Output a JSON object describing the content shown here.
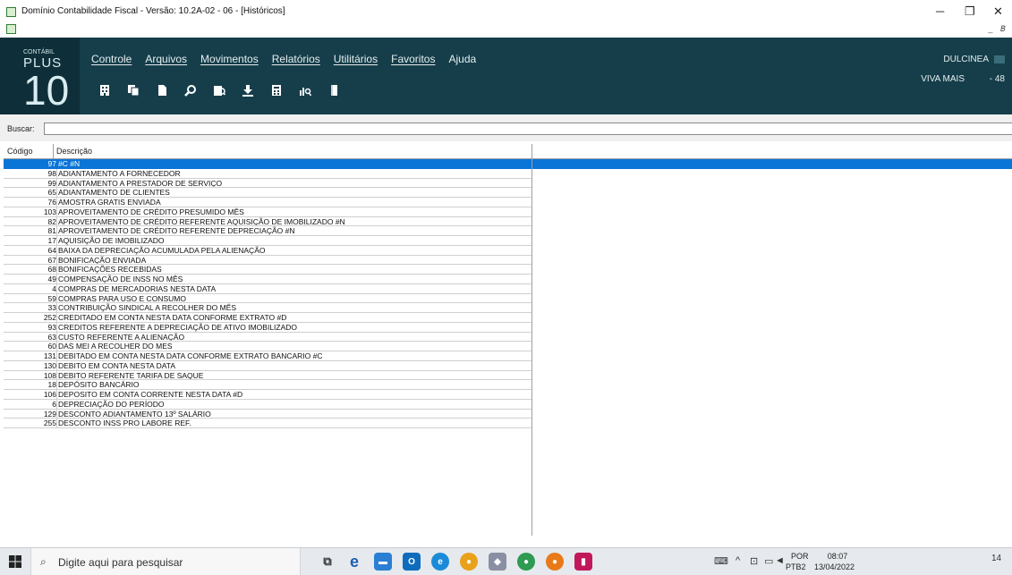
{
  "window": {
    "title": "Domínio Contabilidade Fiscal  - Versão: 10.2A-02 - 06 - [Históricos]"
  },
  "logo": {
    "small": "CONTÁBIL",
    "plus": "PLUS",
    "ten": "10"
  },
  "menu": [
    "Controle",
    "Arquivos",
    "Movimentos",
    "Relatórios",
    "Utilitários",
    "Favoritos",
    "Ajuda"
  ],
  "toolbar_icons": [
    "building-icon",
    "copy-icon",
    "document-icon",
    "search-icon",
    "report-icon",
    "download-icon",
    "calculator-icon",
    "chart-search-icon",
    "exit-door-icon"
  ],
  "user": {
    "name": "DULCINEA",
    "company": "VIVA MAIS",
    "company_code": "- 48"
  },
  "search": {
    "label": "Buscar:",
    "value": ""
  },
  "grid": {
    "headers": {
      "code": "Código",
      "description": "Descrição"
    },
    "rows": [
      {
        "code": "97",
        "desc": "#C #N",
        "selected": true
      },
      {
        "code": "98",
        "desc": "ADIANTAMENTO A FORNECEDOR"
      },
      {
        "code": "99",
        "desc": "ADIANTAMENTO A PRESTADOR DE SERVIÇO"
      },
      {
        "code": "65",
        "desc": "ADIANTAMENTO DE CLIENTES"
      },
      {
        "code": "76",
        "desc": "AMOSTRA GRATIS ENVIADA"
      },
      {
        "code": "103",
        "desc": "APROVEITAMENTO DE CRÉDITO PRESUMIDO MÊS"
      },
      {
        "code": "82",
        "desc": "APROVEITAMENTO DE CRÉDITO REFERENTE AQUISIÇÃO DE IMOBILIZADO #N"
      },
      {
        "code": "81",
        "desc": "APROVEITAMENTO DE CRÉDITO REFERENTE DEPRECIAÇÃO #N"
      },
      {
        "code": "17",
        "desc": "AQUISIÇÃO DE IMOBILIZADO"
      },
      {
        "code": "64",
        "desc": "BAIXA DA DEPRECIAÇÃO ACUMULADA PELA ALIENAÇÃO"
      },
      {
        "code": "67",
        "desc": "BONIFICAÇÃO ENVIADA"
      },
      {
        "code": "68",
        "desc": "BONIFICAÇÕES RECEBIDAS"
      },
      {
        "code": "49",
        "desc": "COMPENSAÇÃO DE INSS NO MÊS"
      },
      {
        "code": "4",
        "desc": "COMPRAS DE MERCADORIAS NESTA DATA"
      },
      {
        "code": "59",
        "desc": "COMPRAS PARA USO E CONSUMO"
      },
      {
        "code": "33",
        "desc": "CONTRIBUIÇÃO SINDICAL A RECOLHER DO MÊS"
      },
      {
        "code": "252",
        "desc": "CREDITADO EM CONTA  NESTA DATA CONFORME EXTRATO #D"
      },
      {
        "code": "93",
        "desc": "CREDITOS REFERENTE A DEPRECIAÇÃO DE ATIVO IMOBILIZADO"
      },
      {
        "code": "63",
        "desc": "CUSTO REFERENTE A ALIENAÇÃO"
      },
      {
        "code": "60",
        "desc": "DAS MEI  A RECOLHER DO MES"
      },
      {
        "code": "131",
        "desc": "DEBITADO EM CONTA  NESTA DATA  CONFORME EXTRATO BANCARIO #C"
      },
      {
        "code": "130",
        "desc": "DEBITO EM CONTA NESTA DATA"
      },
      {
        "code": "108",
        "desc": "DEBITO REFERENTE TARIFA DE SAQUE"
      },
      {
        "code": "18",
        "desc": "DEPÓSITO BANCÁRIO"
      },
      {
        "code": "106",
        "desc": "DEPOSITO EM CONTA CORRENTE NESTA DATA #D"
      },
      {
        "code": "6",
        "desc": "DEPRECIAÇÃO DO PERÍODO"
      },
      {
        "code": "129",
        "desc": "DESCONTO ADIANTAMENTO 13º SALÁRIO"
      },
      {
        "code": "255",
        "desc": "DESCONTO INSS PRO LABORE REF."
      }
    ]
  },
  "taskbar": {
    "search_placeholder": "Digite aqui para pesquisar",
    "lang_top": "POR",
    "lang_bottom": "PTB2",
    "time": "08:07",
    "date": "13/04/2022",
    "notifications": "14"
  }
}
